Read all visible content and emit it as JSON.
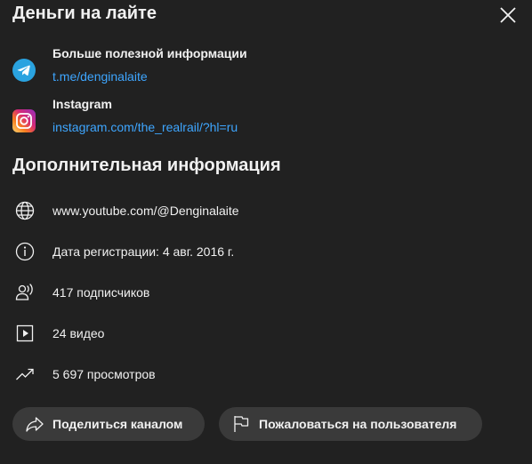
{
  "dialog": {
    "title": "Деньги на лайте"
  },
  "links": [
    {
      "name": "Больше полезной информации",
      "url": "t.me/denginalaite",
      "icon": "telegram-icon"
    },
    {
      "name": "Instagram",
      "url": "instagram.com/the_realrail/?hl=ru",
      "icon": "instagram-icon"
    }
  ],
  "details": {
    "title": "Дополнительная информация",
    "items": [
      {
        "icon": "globe-icon",
        "text": "www.youtube.com/@Denginalaite"
      },
      {
        "icon": "info-icon",
        "text": "Дата регистрации: 4 авг. 2016 г."
      },
      {
        "icon": "subscribers-icon",
        "text": "417 подписчиков"
      },
      {
        "icon": "video-icon",
        "text": "24 видео"
      },
      {
        "icon": "trending-icon",
        "text": "5 697 просмотров"
      }
    ]
  },
  "actions": {
    "share_label": "Поделиться каналом",
    "report_label": "Пожаловаться на пользователя"
  },
  "colors": {
    "background": "#212121",
    "link": "#3ea6ff",
    "button": "#3a3a3a",
    "telegram": "#2aa3e0"
  }
}
